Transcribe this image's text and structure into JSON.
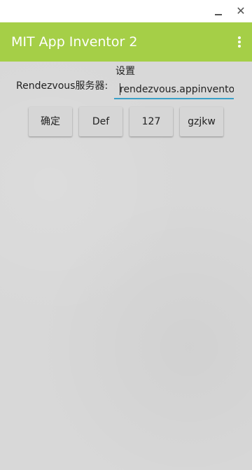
{
  "window": {
    "minimize_glyph": "_",
    "close_glyph": "✕"
  },
  "app_bar": {
    "title": "MIT App Inventor 2",
    "background_color": "#a5cf47",
    "menu_icon": "overflow-menu-icon"
  },
  "form": {
    "settings_label": "设置",
    "server_label": "Rendezvous服务器:",
    "server_value": "rendezvous.appinventor.mit.edu",
    "input_underline_color": "#3aa0c8"
  },
  "buttons": [
    {
      "label": "确定"
    },
    {
      "label": "Def"
    },
    {
      "label": "127"
    },
    {
      "label": "gzjkw"
    }
  ]
}
